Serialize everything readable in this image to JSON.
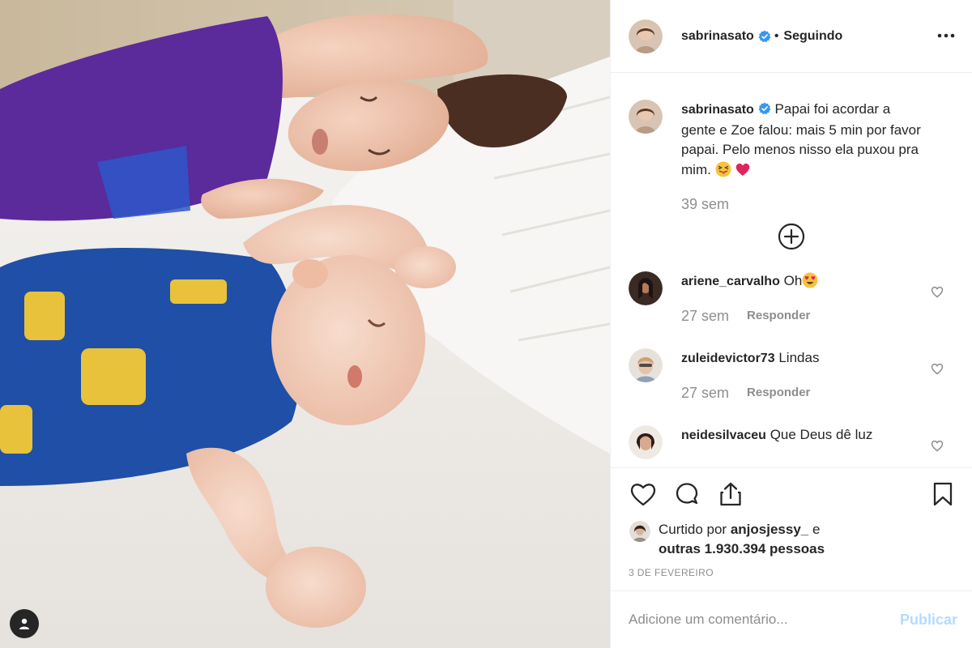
{
  "post": {
    "author": {
      "username": "sabrinasato",
      "verified": true,
      "follow_state": "Seguindo",
      "separator": "•"
    },
    "caption": {
      "text": "Papai foi acordar a gente e Zoe falou: mais 5 min por favor papai. Pelo menos nisso ela puxou pra mim.",
      "emojis": [
        "squinting-face-with-tongue",
        "red-heart"
      ],
      "time": "39 sem"
    },
    "comments": [
      {
        "username": "ariene_carvalho",
        "text": "Oh",
        "emoji": "heart-eyes",
        "time": "27 sem",
        "reply_label": "Responder"
      },
      {
        "username": "zuleidevictor73",
        "text": "Lindas",
        "time": "27 sem",
        "reply_label": "Responder"
      },
      {
        "username": "neidesilvaceu",
        "text": "Que Deus dê luz"
      }
    ],
    "likes": {
      "prefix": "Curtido por",
      "first_liker": "anjosjessy_",
      "connector": "e",
      "others": "outras 1.930.394 pessoas"
    },
    "date": "3 DE FEVEREIRO",
    "add_comment": {
      "placeholder": "Adicione um comentário...",
      "publish_label": "Publicar"
    }
  },
  "colors": {
    "text": "#262626",
    "muted": "#8e8e8e",
    "border": "#efefef",
    "verified_blue": "#3897f0",
    "publish_disabled": "#b3dbff"
  },
  "icons": [
    "more-options-icon",
    "verified-badge-icon",
    "add-circle-icon",
    "heart-icon",
    "comment-icon",
    "share-icon",
    "bookmark-icon",
    "user-tag-icon"
  ]
}
